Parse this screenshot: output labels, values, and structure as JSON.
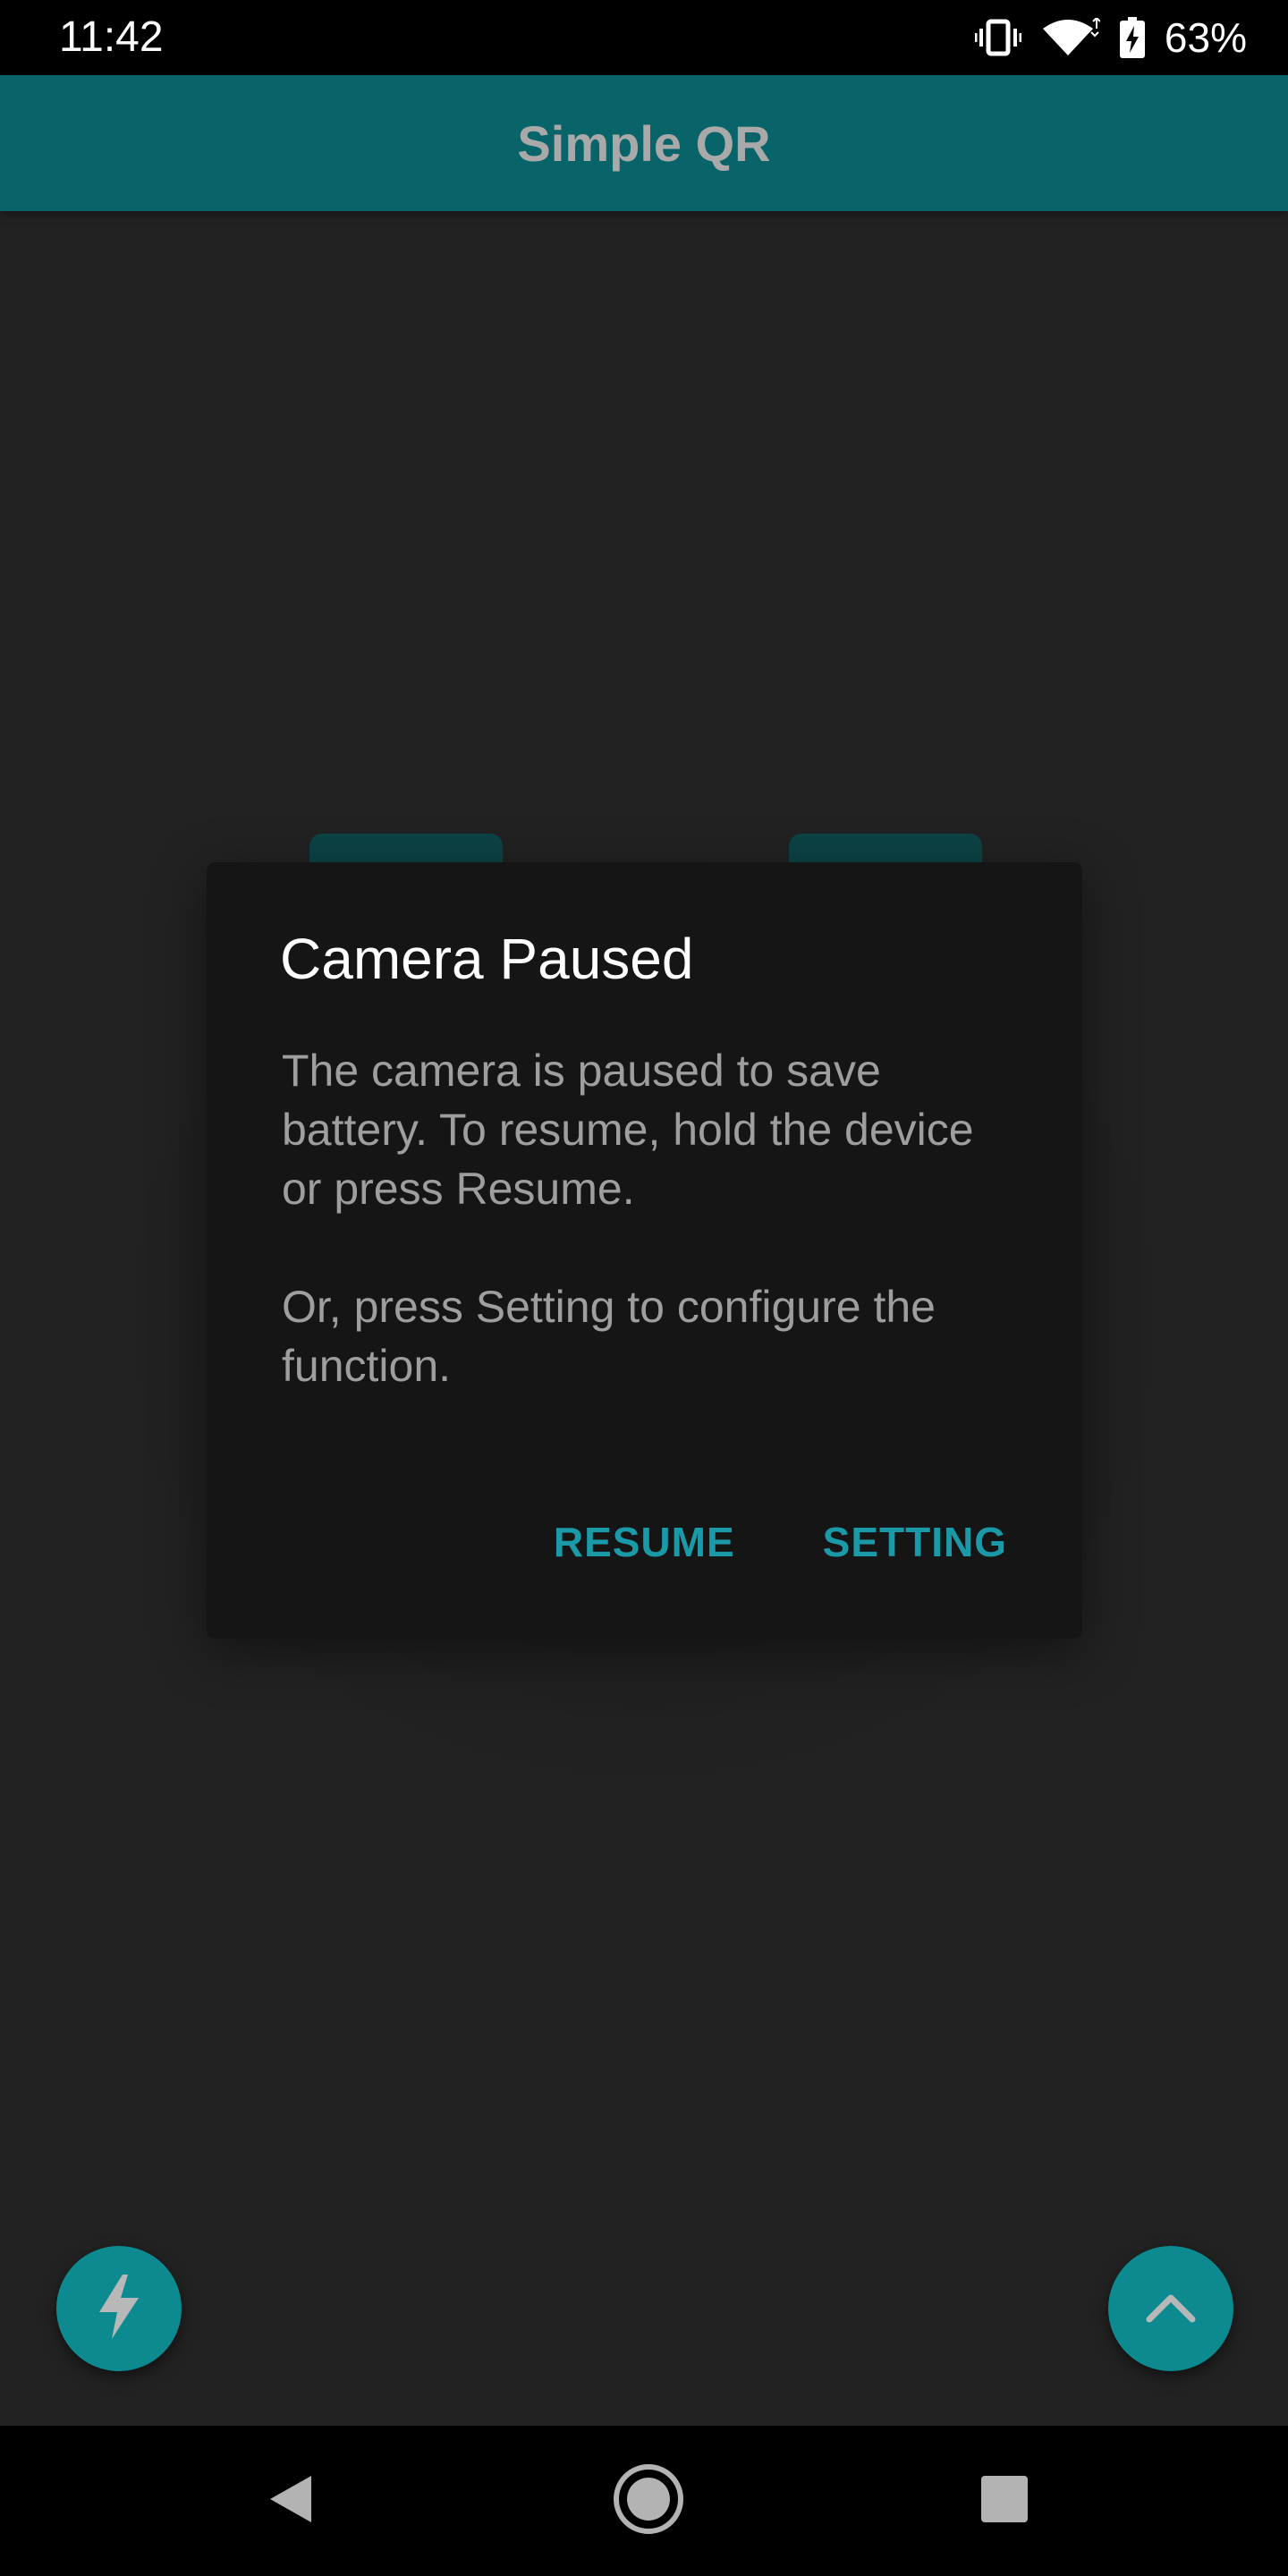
{
  "status_bar": {
    "time": "11:42",
    "battery_percent": "63%",
    "icons": [
      "vibrate-icon",
      "wifi-icon",
      "battery-charging-icon"
    ]
  },
  "app_bar": {
    "title": "Simple QR"
  },
  "dialog": {
    "title": "Camera Paused",
    "message_1": "The camera is paused to save battery. To resume, hold the device or press Resume.",
    "message_2": "Or, press Setting to configure the function.",
    "resume_label": "RESUME",
    "setting_label": "SETTING"
  },
  "fabs": {
    "left_icon": "flash-icon",
    "right_icon": "chevron-up-icon"
  },
  "nav_bar": {
    "icons": [
      "back-icon",
      "home-icon",
      "recents-icon"
    ]
  },
  "colors": {
    "app_bar": "#09646a",
    "accent": "#1a9aa8",
    "fab": "#0c8a90",
    "background": "#222222",
    "dialog": "#151515"
  }
}
